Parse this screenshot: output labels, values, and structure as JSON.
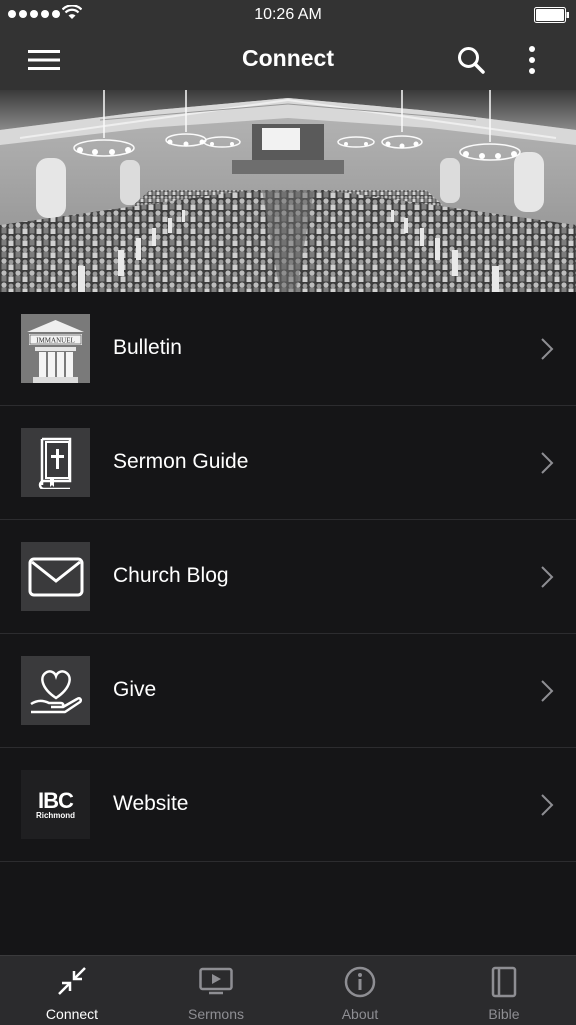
{
  "status_bar": {
    "time": "10:26 AM"
  },
  "nav": {
    "title": "Connect"
  },
  "menu": [
    {
      "label": "Bulletin",
      "icon": "church-building-icon"
    },
    {
      "label": "Sermon Guide",
      "icon": "bible-book-icon"
    },
    {
      "label": "Church Blog",
      "icon": "envelope-icon"
    },
    {
      "label": "Give",
      "icon": "heart-hand-icon"
    },
    {
      "label": "Website",
      "icon": "ibc-logo"
    }
  ],
  "logos": {
    "bulletin_sign": "IMMANUEL",
    "ibc_big": "IBC",
    "ibc_small": "Richmond"
  },
  "tabs": [
    {
      "label": "Connect",
      "active": true
    },
    {
      "label": "Sermons",
      "active": false
    },
    {
      "label": "About",
      "active": false
    },
    {
      "label": "Bible",
      "active": false
    }
  ],
  "colors": {
    "background": "#151517",
    "bar": "#333333",
    "tab_inactive": "#8e8e93"
  }
}
